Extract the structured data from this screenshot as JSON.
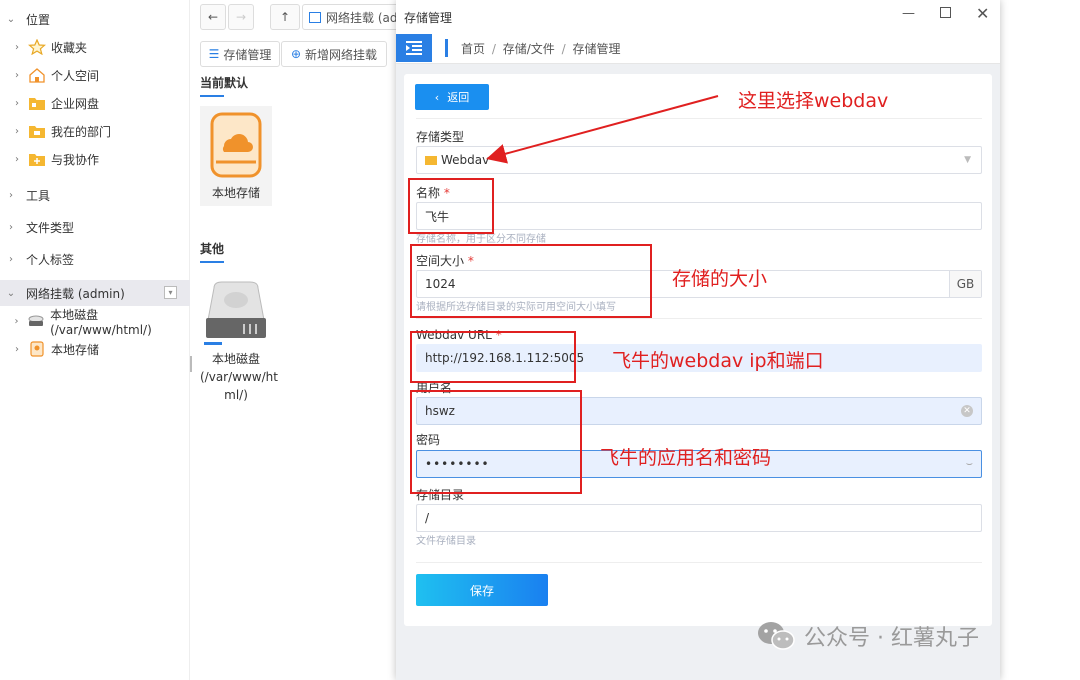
{
  "sidebar": {
    "location_label": "位置",
    "items": [
      {
        "label": "收藏夹"
      },
      {
        "label": "个人空间"
      },
      {
        "label": "企业网盘"
      },
      {
        "label": "我在的部门"
      },
      {
        "label": "与我协作"
      }
    ],
    "groups": [
      {
        "label": "工具"
      },
      {
        "label": "文件类型"
      },
      {
        "label": "个人标签"
      }
    ],
    "network_mount": {
      "label": "网络挂载 (admin)",
      "children": [
        {
          "label": "本地磁盘(/var/www/html/)"
        },
        {
          "label": "本地存储"
        }
      ]
    }
  },
  "explorer": {
    "address": "网络挂载 (adı",
    "buttons": {
      "storage_manage": "存储管理",
      "add_mount": "新增网络挂载"
    },
    "section_default": "当前默认",
    "default_item": "本地存储",
    "section_other": "其他",
    "other_item_line1": "本地磁盘",
    "other_item_line2": "(/var/www/ht",
    "other_item_line3": "ml/)"
  },
  "modal": {
    "title": "存储管理",
    "breadcrumb": [
      "首页",
      "存储/文件",
      "存储管理"
    ],
    "back_label": "返回",
    "fields": {
      "storage_type": {
        "label": "存储类型",
        "value": "Webdav"
      },
      "name": {
        "label": "名称",
        "value": "飞牛",
        "hint": "存储名称，用于区分不同存储"
      },
      "size": {
        "label": "空间大小",
        "value": "1024",
        "unit": "GB",
        "hint": "请根据所选存储目录的实际可用空间大小填写"
      },
      "url": {
        "label": "Webdav URL",
        "value": "http://192.168.1.112:5005"
      },
      "username": {
        "label": "用户名",
        "value": "hswz"
      },
      "password": {
        "label": "密码",
        "value": "••••••••"
      },
      "directory": {
        "label": "存储目录",
        "value": "/",
        "hint": "文件存储目录"
      }
    },
    "save_label": "保存"
  },
  "annotations": {
    "select_webdav": "这里选择webdav",
    "storage_size": "存储的大小",
    "ip_port": "飞牛的webdav ip和端口",
    "app_credentials": "飞牛的应用名和密码"
  },
  "watermark": "公众号 · 红薯丸子",
  "colors": {
    "accent": "#2a7fe4",
    "annotation": "#e02020",
    "save_button": "#1a8ff0"
  }
}
